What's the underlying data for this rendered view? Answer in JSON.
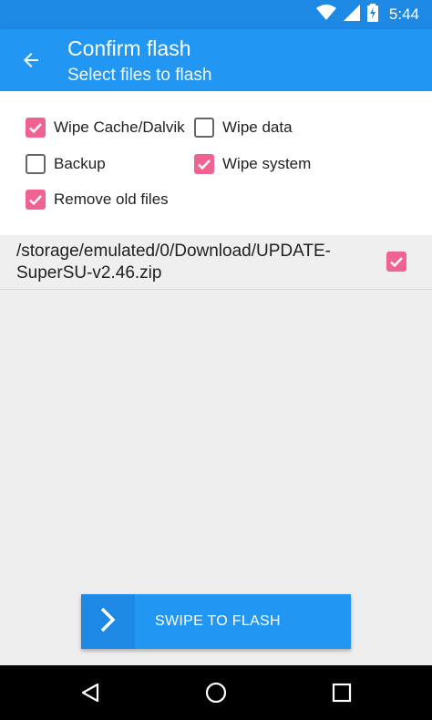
{
  "status_bar": {
    "time": "5:44",
    "icons": [
      "wifi-icon",
      "signal-icon",
      "battery-charging-icon"
    ],
    "color": "#1e88e5"
  },
  "app_bar": {
    "title": "Confirm flash",
    "subtitle": "Select files to flash",
    "back_icon": "arrow-back-icon",
    "color": "#2196f3"
  },
  "options": [
    {
      "label": "Wipe Cache/Dalvik",
      "checked": true
    },
    {
      "label": "Wipe data",
      "checked": false
    },
    {
      "label": "Backup",
      "checked": false
    },
    {
      "label": "Wipe system",
      "checked": true
    },
    {
      "label": "Remove old files",
      "checked": true
    }
  ],
  "files": [
    {
      "path": "/storage/emulated/0/Download/UPDATE-SuperSU-v2.46.zip",
      "checked": true
    }
  ],
  "swipe_button": {
    "label": "SWIPE TO FLASH",
    "icon": "chevron-right-icon"
  },
  "nav_bar": {
    "buttons": [
      "back-triangle-icon",
      "home-circle-icon",
      "recents-square-icon"
    ]
  },
  "accent_color": "#f06292"
}
